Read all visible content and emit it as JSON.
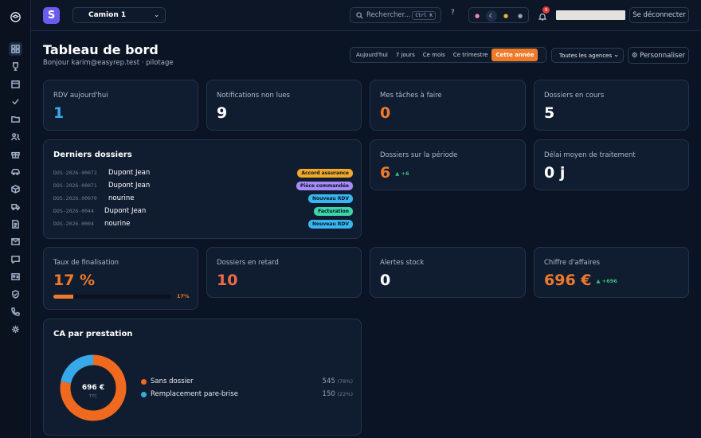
{
  "topbar": {
    "brand_letter": "S",
    "vehicle": "Camion 1",
    "search_placeholder": "Rechercher...",
    "search_shortcut": "Ctrl K",
    "help": "?",
    "notif_count": "9",
    "logout": "Se déconnecter"
  },
  "header": {
    "title": "Tableau de bord",
    "subtitle": "Bonjour karim@easyrep.test · pilotage"
  },
  "periods": [
    {
      "label": "Aujourd'hui",
      "active": false
    },
    {
      "label": "7 jours",
      "active": false
    },
    {
      "label": "Ce mois",
      "active": false
    },
    {
      "label": "Ce trimestre",
      "active": false
    },
    {
      "label": "Cette année",
      "active": true
    }
  ],
  "agency": "Toutes les agences",
  "personalize": "⚙ Personnaliser",
  "kpis": {
    "rdv": {
      "label": "RDV aujourd'hui",
      "value": "1"
    },
    "notifs": {
      "label": "Notifications non lues",
      "value": "9"
    },
    "tasks": {
      "label": "Mes tâches à faire",
      "value": "0"
    },
    "ongoing": {
      "label": "Dossiers en cours",
      "value": "5"
    },
    "period": {
      "label": "Dossiers sur la période",
      "value": "6",
      "delta": "▲ +6"
    },
    "delay": {
      "label": "Délai moyen de traitement",
      "value": "0 j"
    },
    "finalisation": {
      "label": "Taux de finalisation",
      "value": "17 %",
      "pct_label": "17%",
      "pct": 17
    },
    "late": {
      "label": "Dossiers en retard",
      "value": "10"
    },
    "stock": {
      "label": "Alertes stock",
      "value": "0"
    },
    "revenue": {
      "label": "Chiffre d'affaires",
      "value": "696 €",
      "delta": "▲ +696"
    }
  },
  "dossiers": {
    "title": "Derniers dossiers",
    "rows": [
      {
        "id": "DOS-2026-00072",
        "name": "Dupont Jean",
        "tag": "Accord assurance",
        "color": "#f0a92a"
      },
      {
        "id": "DOS-2026-00071",
        "name": "Dupont Jean",
        "tag": "Pièce commandée",
        "color": "#a78bfa"
      },
      {
        "id": "DOS.2026.00070",
        "name": "nourine",
        "tag": "Nouveau RDV",
        "color": "#38b6f0"
      },
      {
        "id": "DOS-2026-0044",
        "name": "Dupont Jean",
        "tag": "Facturation",
        "color": "#3dd6a8"
      },
      {
        "id": "DOS-2026-0004",
        "name": "nourine",
        "tag": "Nouveau RDV",
        "color": "#38b6f0"
      }
    ]
  },
  "ca": {
    "title": "CA par prestation",
    "total": "696 €",
    "total_sub": "TTC",
    "items": [
      {
        "label": "Sans dossier",
        "value": "545",
        "pct": "(78%)",
        "color": "#ef6a1f",
        "share": 78
      },
      {
        "label": "Remplacement pare-brise",
        "value": "150",
        "pct": "(22%)",
        "color": "#38a9e8",
        "share": 22
      }
    ]
  }
}
